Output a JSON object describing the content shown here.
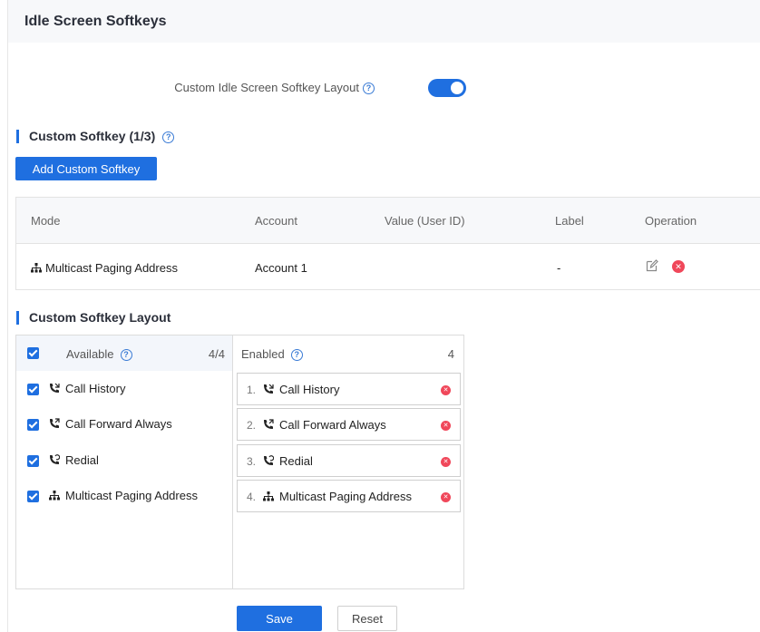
{
  "header": {
    "title": "Idle Screen Softkeys"
  },
  "toggle": {
    "label": "Custom Idle Screen Softkey Layout",
    "enabled": true
  },
  "custom_softkey": {
    "title": "Custom Softkey (1/3)",
    "add_button": "Add Custom Softkey",
    "columns": [
      "Mode",
      "Account",
      "Value (User ID)",
      "Label",
      "Operation"
    ],
    "rows": [
      {
        "mode": "Multicast Paging Address",
        "mode_icon": "network-icon",
        "account": "Account 1",
        "value": "",
        "label": "-"
      }
    ]
  },
  "layout": {
    "title": "Custom Softkey Layout",
    "available": {
      "title": "Available",
      "count": "4/4",
      "items": [
        {
          "label": "Call History",
          "icon": "phone-icon"
        },
        {
          "label": "Call Forward Always",
          "icon": "phone-icon"
        },
        {
          "label": "Redial",
          "icon": "phone-icon"
        },
        {
          "label": "Multicast Paging Address",
          "icon": "network-icon"
        }
      ]
    },
    "enabled": {
      "title": "Enabled",
      "count": "4",
      "items": [
        {
          "num": "1.",
          "label": "Call History",
          "icon": "phone-icon"
        },
        {
          "num": "2.",
          "label": "Call Forward Always",
          "icon": "phone-icon"
        },
        {
          "num": "3.",
          "label": "Redial",
          "icon": "phone-icon"
        },
        {
          "num": "4.",
          "label": "Multicast Paging Address",
          "icon": "network-icon"
        }
      ]
    }
  },
  "actions": {
    "save": "Save",
    "reset": "Reset"
  },
  "colors": {
    "accent": "#1f6fe0",
    "danger": "#f0475a"
  }
}
